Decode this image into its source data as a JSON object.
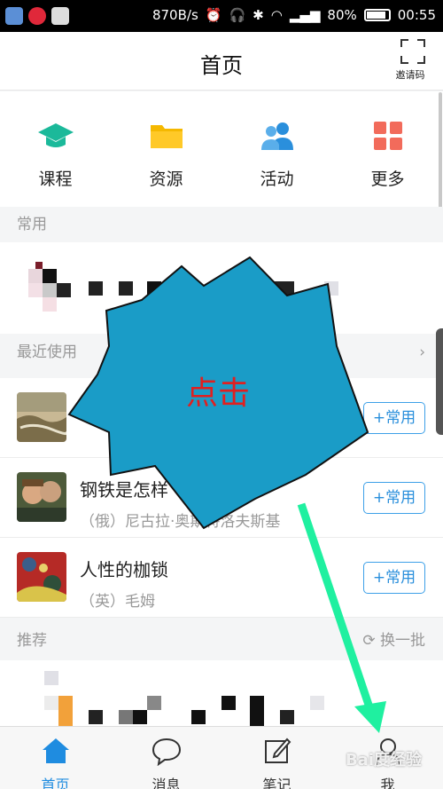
{
  "status_bar": {
    "speed": "870B/s",
    "battery": "80%",
    "battery_level": 0.8,
    "time": "00:55",
    "icons": [
      "app-icon-shield",
      "app-icon-weibo",
      "app-icon-qq",
      "alarm-icon",
      "headphone-icon",
      "bluetooth-icon",
      "wifi-icon",
      "signal-icon",
      "signal-icon",
      "battery-icon"
    ]
  },
  "header": {
    "title": "首页",
    "invite_label": "邀请码"
  },
  "quick_nav": [
    {
      "label": "课程",
      "icon": "graduation-cap-icon",
      "color": "#1bb99a"
    },
    {
      "label": "资源",
      "icon": "folder-icon",
      "color": "#f5b800"
    },
    {
      "label": "活动",
      "icon": "people-icon",
      "color": "#2a8fdc"
    },
    {
      "label": "更多",
      "icon": "grid-icon",
      "color": "#f26b5b"
    }
  ],
  "sections": {
    "common": "常用",
    "recent": "最近使用",
    "recommend": "推荐",
    "refresh": "换一批"
  },
  "recent_items": [
    {
      "title": "",
      "author": "",
      "button": "+常用"
    },
    {
      "title": "钢铁是怎样",
      "author": "（俄）尼古拉·奥斯特洛夫斯基",
      "button": "+常用"
    },
    {
      "title": "人性的枷锁",
      "author": "（英）毛姆",
      "button": "+常用"
    }
  ],
  "annotation": {
    "callout_text": "点击",
    "callout_color": "#1a9cc7",
    "arrow_color": "#1ff0a0"
  },
  "tabs": [
    {
      "label": "首页",
      "icon": "home-icon",
      "active": true
    },
    {
      "label": "消息",
      "icon": "chat-bubble-icon",
      "active": false
    },
    {
      "label": "笔记",
      "icon": "note-edit-icon",
      "active": false
    },
    {
      "label": "我",
      "icon": "person-icon",
      "active": false
    }
  ],
  "watermark": "Bai度经验",
  "colors": {
    "accent": "#1f8ce0",
    "button_border": "#3da0e8"
  }
}
